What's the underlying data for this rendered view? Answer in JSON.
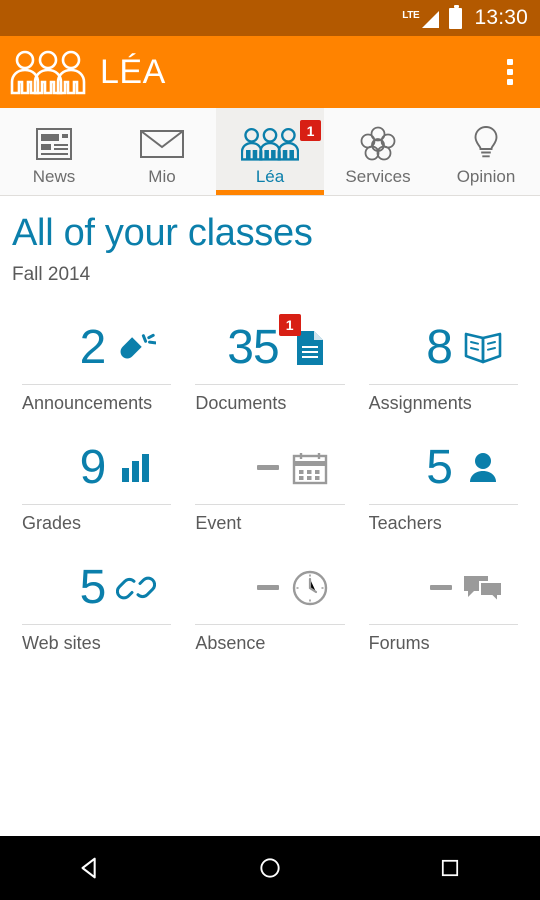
{
  "status_bar": {
    "network": "LTE",
    "network_icon": "signal-bars-icon",
    "battery_icon": "battery-icon",
    "time": "13:30",
    "background": "#b35900"
  },
  "app_bar": {
    "logo_icon": "three-people-icon",
    "title": "LÉA",
    "overflow_icon": "overflow-menu-icon",
    "background": "#ff8300"
  },
  "tabs": [
    {
      "label": "News",
      "icon": "newspaper-icon",
      "active": false,
      "badge": null
    },
    {
      "label": "Mio",
      "icon": "envelope-icon",
      "active": false,
      "badge": null
    },
    {
      "label": "Léa",
      "icon": "three-people-icon",
      "active": true,
      "badge": "1"
    },
    {
      "label": "Services",
      "icon": "flower-icon",
      "active": false,
      "badge": null
    },
    {
      "label": "Opinion",
      "icon": "lightbulb-icon",
      "active": false,
      "badge": null
    }
  ],
  "page": {
    "title": "All of your classes",
    "subtitle": "Fall 2014",
    "title_color": "#0b7fab"
  },
  "tiles": [
    {
      "value": "2",
      "label": "Announcements",
      "icon": "megaphone-icon",
      "badge": null,
      "muted": false
    },
    {
      "value": "35",
      "label": "Documents",
      "icon": "document-icon",
      "badge": "1",
      "muted": false
    },
    {
      "value": "8",
      "label": "Assignments",
      "icon": "open-book-icon",
      "badge": null,
      "muted": false
    },
    {
      "value": "9",
      "label": "Grades",
      "icon": "bar-chart-icon",
      "badge": null,
      "muted": false
    },
    {
      "value": "–",
      "label": "Event",
      "icon": "calendar-icon",
      "badge": null,
      "muted": true
    },
    {
      "value": "5",
      "label": "Teachers",
      "icon": "person-icon",
      "badge": null,
      "muted": false
    },
    {
      "value": "5",
      "label": "Web sites",
      "icon": "link-icon",
      "badge": null,
      "muted": false
    },
    {
      "value": "–",
      "label": "Absence",
      "icon": "clock-icon",
      "badge": null,
      "muted": true
    },
    {
      "value": "–",
      "label": "Forums",
      "icon": "chat-bubbles-icon",
      "badge": null,
      "muted": true
    }
  ],
  "nav_bar": {
    "back_icon": "back-triangle-icon",
    "home_icon": "home-circle-icon",
    "recents_icon": "recents-square-icon"
  },
  "colors": {
    "accent_blue": "#0b7fab",
    "brand_orange": "#ff8300",
    "badge_red": "#d81f14",
    "muted_gray": "#9a9a9a"
  }
}
